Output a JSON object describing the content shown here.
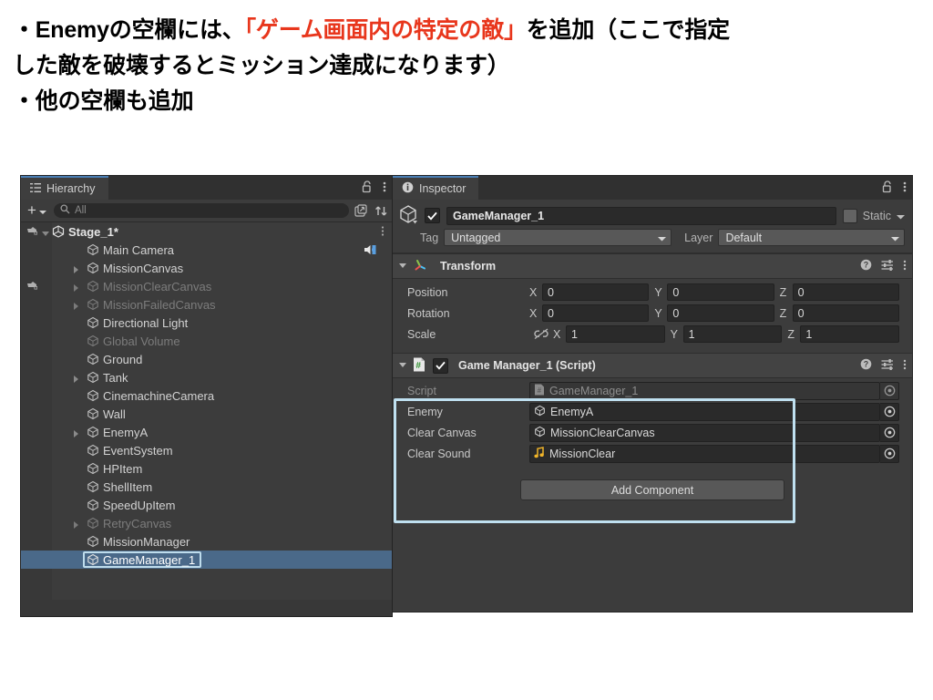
{
  "caption": {
    "line1_a": "・Enemyの空欄には、",
    "line1_hl": "「ゲーム画面内の特定の敵」",
    "line1_b": "を追加（ここで指定",
    "line2": "した敵を破壊するとミッション達成になります）",
    "line3": "・他の空欄も追加",
    "highlight_color": "#e8361c"
  },
  "hierarchy": {
    "tab_label": "Hierarchy",
    "tab_icon": "hierarchy-icon",
    "lock_icon": "lock-open-icon",
    "menu_icon": "kebab-menu-icon",
    "add_label": "+",
    "search_placeholder": "All",
    "search_icon": "search-icon",
    "filter_icon": "filter-window-icon",
    "sort_icon": "sort-icon",
    "items": [
      {
        "name": "Stage_1*",
        "depth": 0,
        "expanded": true,
        "dim": false,
        "root": true,
        "vis": true,
        "arrow": true,
        "kebab": true
      },
      {
        "name": "Main Camera",
        "depth": 1,
        "expanded": false,
        "dim": false,
        "root": false,
        "vis": false,
        "arrow": false,
        "audio": true
      },
      {
        "name": "MissionCanvas",
        "depth": 1,
        "expanded": false,
        "dim": false,
        "root": false,
        "vis": false,
        "arrow": true
      },
      {
        "name": "MissionClearCanvas",
        "depth": 1,
        "expanded": false,
        "dim": true,
        "root": false,
        "vis": true,
        "arrow": true
      },
      {
        "name": "MissionFailedCanvas",
        "depth": 1,
        "expanded": false,
        "dim": true,
        "root": false,
        "vis": false,
        "arrow": true
      },
      {
        "name": "Directional Light",
        "depth": 1,
        "expanded": false,
        "dim": false,
        "root": false,
        "vis": false,
        "arrow": false
      },
      {
        "name": "Global Volume",
        "depth": 1,
        "expanded": false,
        "dim": true,
        "root": false,
        "vis": false,
        "arrow": false
      },
      {
        "name": "Ground",
        "depth": 1,
        "expanded": false,
        "dim": false,
        "root": false,
        "vis": false,
        "arrow": false
      },
      {
        "name": "Tank",
        "depth": 1,
        "expanded": false,
        "dim": false,
        "root": false,
        "vis": false,
        "arrow": true
      },
      {
        "name": "CinemachineCamera",
        "depth": 1,
        "expanded": false,
        "dim": false,
        "root": false,
        "vis": false,
        "arrow": false
      },
      {
        "name": "Wall",
        "depth": 1,
        "expanded": false,
        "dim": false,
        "root": false,
        "vis": false,
        "arrow": false
      },
      {
        "name": "EnemyA",
        "depth": 1,
        "expanded": false,
        "dim": false,
        "root": false,
        "vis": false,
        "arrow": true
      },
      {
        "name": "EventSystem",
        "depth": 1,
        "expanded": false,
        "dim": false,
        "root": false,
        "vis": false,
        "arrow": false
      },
      {
        "name": "HPItem",
        "depth": 1,
        "expanded": false,
        "dim": false,
        "root": false,
        "vis": false,
        "arrow": false
      },
      {
        "name": "ShellItem",
        "depth": 1,
        "expanded": false,
        "dim": false,
        "root": false,
        "vis": false,
        "arrow": false
      },
      {
        "name": "SpeedUpItem",
        "depth": 1,
        "expanded": false,
        "dim": false,
        "root": false,
        "vis": false,
        "arrow": false
      },
      {
        "name": "RetryCanvas",
        "depth": 1,
        "expanded": false,
        "dim": true,
        "root": false,
        "vis": false,
        "arrow": true
      },
      {
        "name": "MissionManager",
        "depth": 1,
        "expanded": false,
        "dim": false,
        "root": false,
        "vis": false,
        "arrow": false
      },
      {
        "name": "GameManager_1",
        "depth": 1,
        "expanded": false,
        "dim": false,
        "root": false,
        "vis": false,
        "arrow": false,
        "selected": true,
        "boxed": true
      }
    ]
  },
  "inspector": {
    "tab_label": "Inspector",
    "tab_icon": "info-icon",
    "lock_icon": "lock-open-icon",
    "menu_icon": "kebab-menu-icon",
    "object_icon": "gameobject-cube-icon",
    "enabled": true,
    "object_name": "GameManager_1",
    "static_label": "Static",
    "static_checked": false,
    "tag_label": "Tag",
    "tag_value": "Untagged",
    "layer_label": "Layer",
    "layer_value": "Default",
    "components": [
      {
        "title": "Transform",
        "icon": "transform-axes-icon",
        "help_icon": "help-icon",
        "preset_icon": "preset-icon",
        "menu_icon": "kebab-menu-icon",
        "expanded": true,
        "has_toggle": false,
        "rows": [
          {
            "label": "Position",
            "type": "vector3",
            "x": "0",
            "y": "0",
            "z": "0",
            "link_icon": false
          },
          {
            "label": "Rotation",
            "type": "vector3",
            "x": "0",
            "y": "0",
            "z": "0",
            "link_icon": false
          },
          {
            "label": "Scale",
            "type": "vector3",
            "x": "1",
            "y": "1",
            "z": "1",
            "link_icon": true
          }
        ]
      },
      {
        "title": "Game Manager_1 (Script)",
        "icon": "csharp-script-icon",
        "help_icon": "help-icon",
        "preset_icon": "preset-icon",
        "menu_icon": "kebab-menu-icon",
        "expanded": true,
        "has_toggle": true,
        "enabled": true,
        "highlighted": true,
        "rows": [
          {
            "label": "Script",
            "type": "object",
            "value": "GameManager_1",
            "value_icon": "csharp-script-icon",
            "dim": true
          },
          {
            "label": "Enemy",
            "type": "object",
            "value": "EnemyA",
            "value_icon": "gameobject-cube-icon",
            "dim": false
          },
          {
            "label": "Clear Canvas",
            "type": "object",
            "value": "MissionClearCanvas",
            "value_icon": "gameobject-cube-icon",
            "dim": false
          },
          {
            "label": "Clear Sound",
            "type": "object",
            "value": "MissionClear",
            "value_icon": "audioclip-icon",
            "dim": false
          }
        ]
      }
    ],
    "add_component_label": "Add Component"
  },
  "colors": {
    "panel_bg": "#3c3c3c",
    "header_bg": "#434343",
    "selection": "#4a6989",
    "highlight_border": "#bfe0f0",
    "accent_blue": "#4a7fb5",
    "audio_icon": "#f5c542"
  },
  "axis_labels": {
    "x": "X",
    "y": "Y",
    "z": "Z"
  }
}
